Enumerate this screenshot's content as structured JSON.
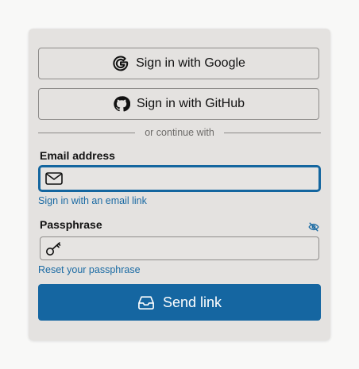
{
  "oauth": {
    "google_label": "Sign in with Google",
    "github_label": "Sign in with GitHub"
  },
  "divider": {
    "text": "or continue with"
  },
  "email": {
    "label": "Email address",
    "value": "",
    "placeholder": "",
    "link_label": "Sign in with an email link",
    "icon": "mail-icon"
  },
  "passphrase": {
    "label": "Passphrase",
    "value": "",
    "placeholder": "",
    "link_label": "Reset your passphrase",
    "icon": "key-icon",
    "toggle_icon": "eye-off-icon"
  },
  "submit": {
    "label": "Send link",
    "icon": "inbox-icon"
  },
  "colors": {
    "accent": "#1566a1",
    "link": "#1a6aa3",
    "card_bg": "#e4e2e0",
    "page_bg": "#f8f8f7"
  }
}
